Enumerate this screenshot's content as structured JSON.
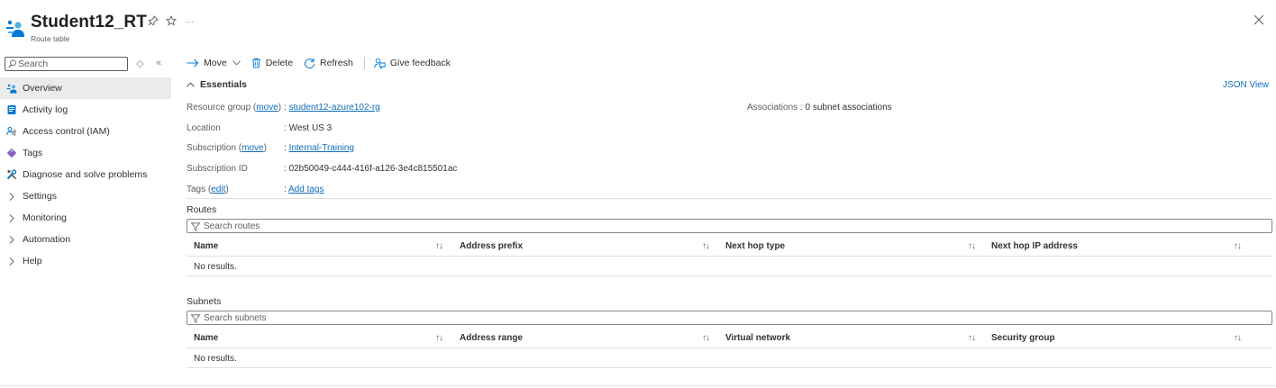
{
  "header": {
    "title": "Student12_RT",
    "subtitle": "Route table",
    "pin_icon": "pin-icon",
    "favorite_icon": "star-icon",
    "more_label": "···",
    "close_icon": "close-icon"
  },
  "sidebar": {
    "search_placeholder": "Search",
    "items": [
      {
        "label": "Overview",
        "icon": "route-table-icon",
        "active": true
      },
      {
        "label": "Activity log",
        "icon": "activity-log-icon"
      },
      {
        "label": "Access control (IAM)",
        "icon": "iam-icon"
      },
      {
        "label": "Tags",
        "icon": "tag-icon"
      },
      {
        "label": "Diagnose and solve problems",
        "icon": "wrench-icon"
      },
      {
        "label": "Settings",
        "icon": "chevron-right-icon"
      },
      {
        "label": "Monitoring",
        "icon": "chevron-right-icon"
      },
      {
        "label": "Automation",
        "icon": "chevron-right-icon"
      },
      {
        "label": "Help",
        "icon": "chevron-right-icon"
      }
    ]
  },
  "toolbar": {
    "move_label": "Move",
    "delete_label": "Delete",
    "refresh_label": "Refresh",
    "feedback_label": "Give feedback"
  },
  "essentials": {
    "title": "Essentials",
    "json_view": "JSON View",
    "resource_group_label": "Resource group",
    "move_link": "move",
    "resource_group_value": "student12-azure102-rg",
    "location_label": "Location",
    "location_value": "West US 3",
    "subscription_label": "Subscription",
    "subscription_value": "Internal-Training",
    "subscription_id_label": "Subscription ID",
    "subscription_id_value": "02b50049-c444-416f-a126-3e4c815501ac",
    "tags_label": "Tags",
    "edit_link": "edit",
    "tags_value": "Add tags",
    "associations_label": "Associations",
    "associations_value": "0 subnet associations",
    "separator": ":"
  },
  "routes": {
    "title": "Routes",
    "search_placeholder": "Search routes",
    "columns": [
      "Name",
      "Address prefix",
      "Next hop type",
      "Next hop IP address"
    ],
    "empty": "No results."
  },
  "subnets": {
    "title": "Subnets",
    "search_placeholder": "Search subnets",
    "columns": [
      "Name",
      "Address range",
      "Virtual network",
      "Security group"
    ],
    "empty": "No results."
  },
  "colors": {
    "accent": "#0f6cbd",
    "active_bg": "#edebe9"
  }
}
